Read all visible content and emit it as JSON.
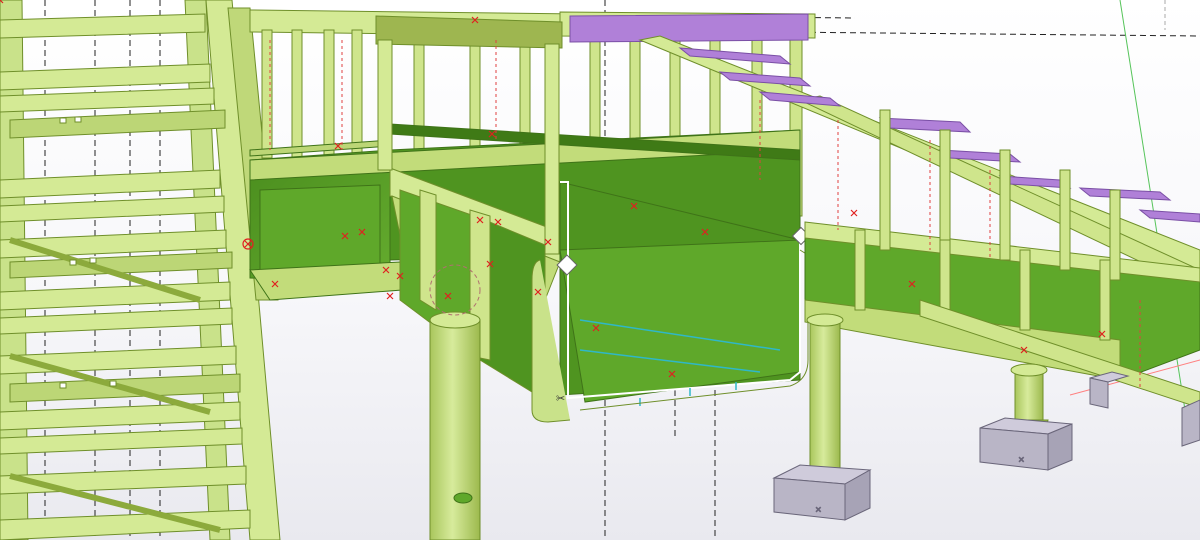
{
  "viewport": {
    "name": "3d-model-view",
    "background_top": "#ffffff",
    "background_bottom": "#e9e9ef"
  },
  "palette": {
    "steel_light": "#d4ea95",
    "steel_mid": "#c2dc7a",
    "steel_edge": "#6f8f2a",
    "plate_dark": "#4f9420",
    "plate_mid": "#5fa82a",
    "stair_tread": "#b080d8",
    "concrete_base": "#b9b5c6",
    "work_point": "#e02020",
    "grid_line": "#222222",
    "selection_outline": "#ffffff"
  },
  "model": {
    "left_tower": "steel-tower-frame",
    "walkway": "bridge-walkway",
    "selected_part": "bent-plate-part",
    "stair": "stair-flight",
    "columns": [
      "circular-column-center",
      "circular-column-right",
      "circular-column-far"
    ],
    "footings": [
      "concrete-footing-1",
      "concrete-footing-2",
      "concrete-footing-3"
    ]
  }
}
